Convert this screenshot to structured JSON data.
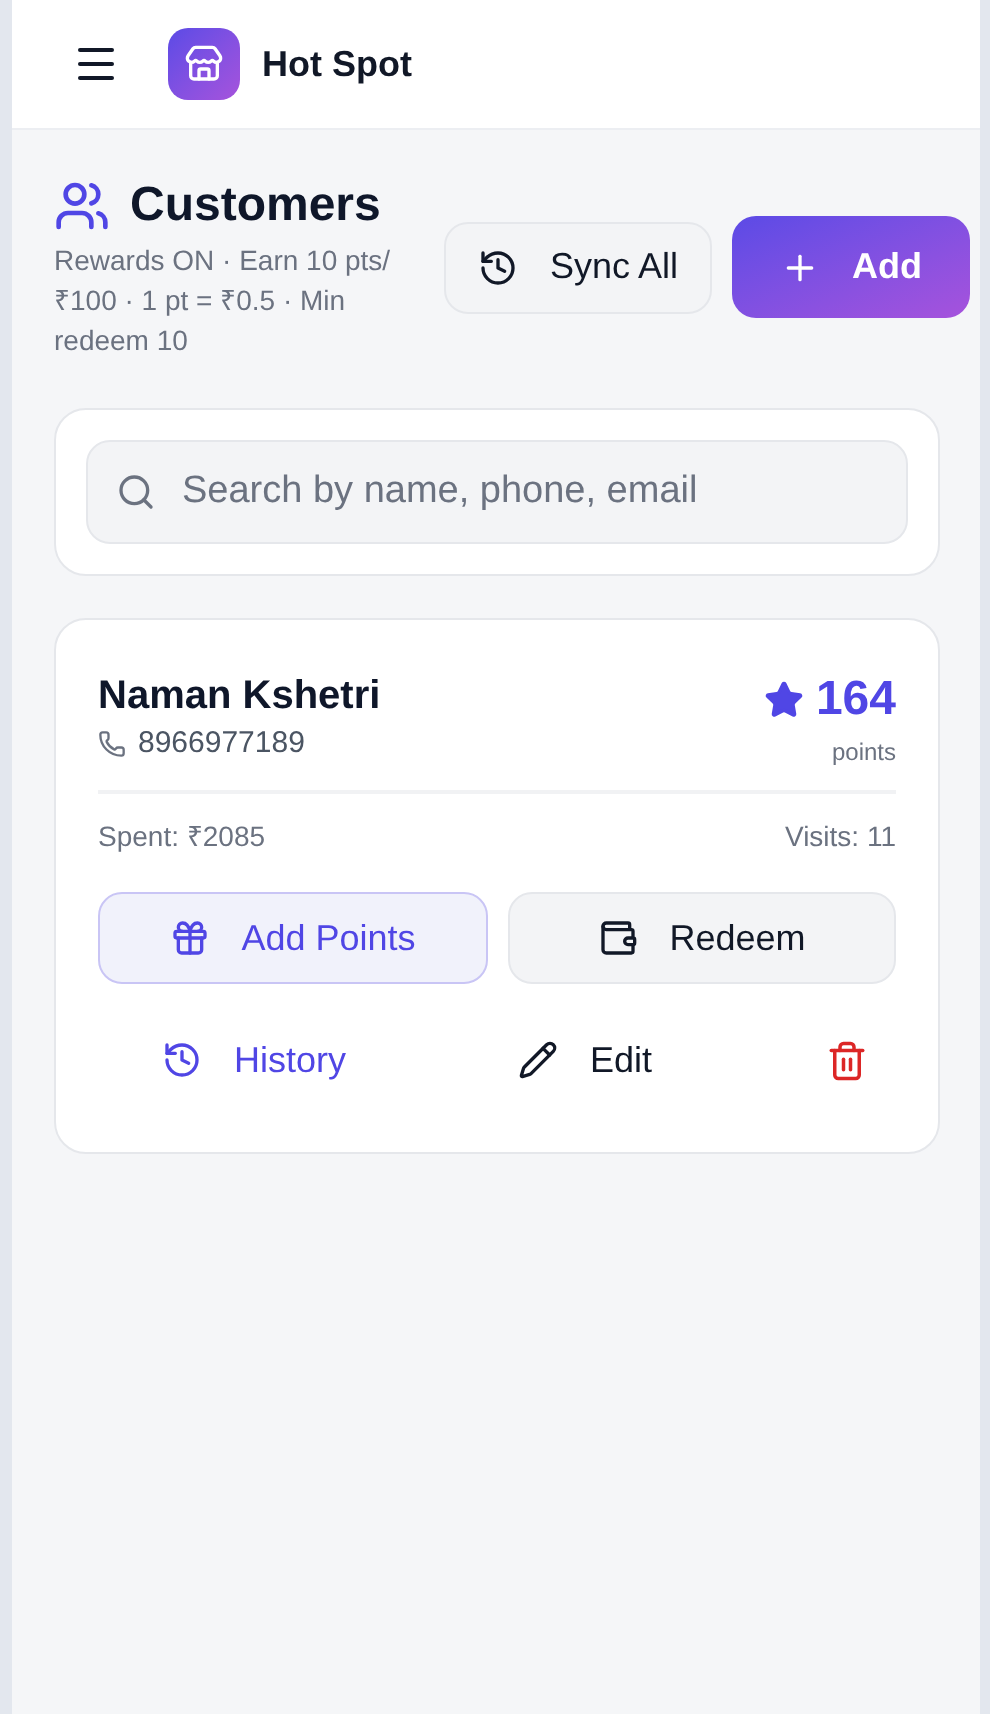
{
  "header": {
    "title": "Hot Spot"
  },
  "page": {
    "title": "Customers",
    "subtitle": "Rewards ON · Earn 10 pts/₹100 · 1 pt = ₹0.5 · Min redeem 10",
    "buttons": [
      {
        "label": "Sync All",
        "kind": "secondary"
      },
      {
        "label": "Add",
        "kind": "primary"
      }
    ]
  },
  "search": {
    "placeholder": "Search by name, phone, email"
  },
  "customers": [
    {
      "name": "Naman Kshetri",
      "phone": "8966977189",
      "points": "164",
      "points_label": "points",
      "spent": "Spent: ₹2085",
      "visits": "Visits: 11",
      "actions": [
        {
          "label": "Add Points",
          "kind": "add_points"
        },
        {
          "label": "Redeem",
          "kind": "redeem"
        },
        {
          "label": "History",
          "kind": "history"
        },
        {
          "label": "Edit",
          "kind": "edit"
        },
        {
          "kind": "delete"
        }
      ]
    }
  ]
}
